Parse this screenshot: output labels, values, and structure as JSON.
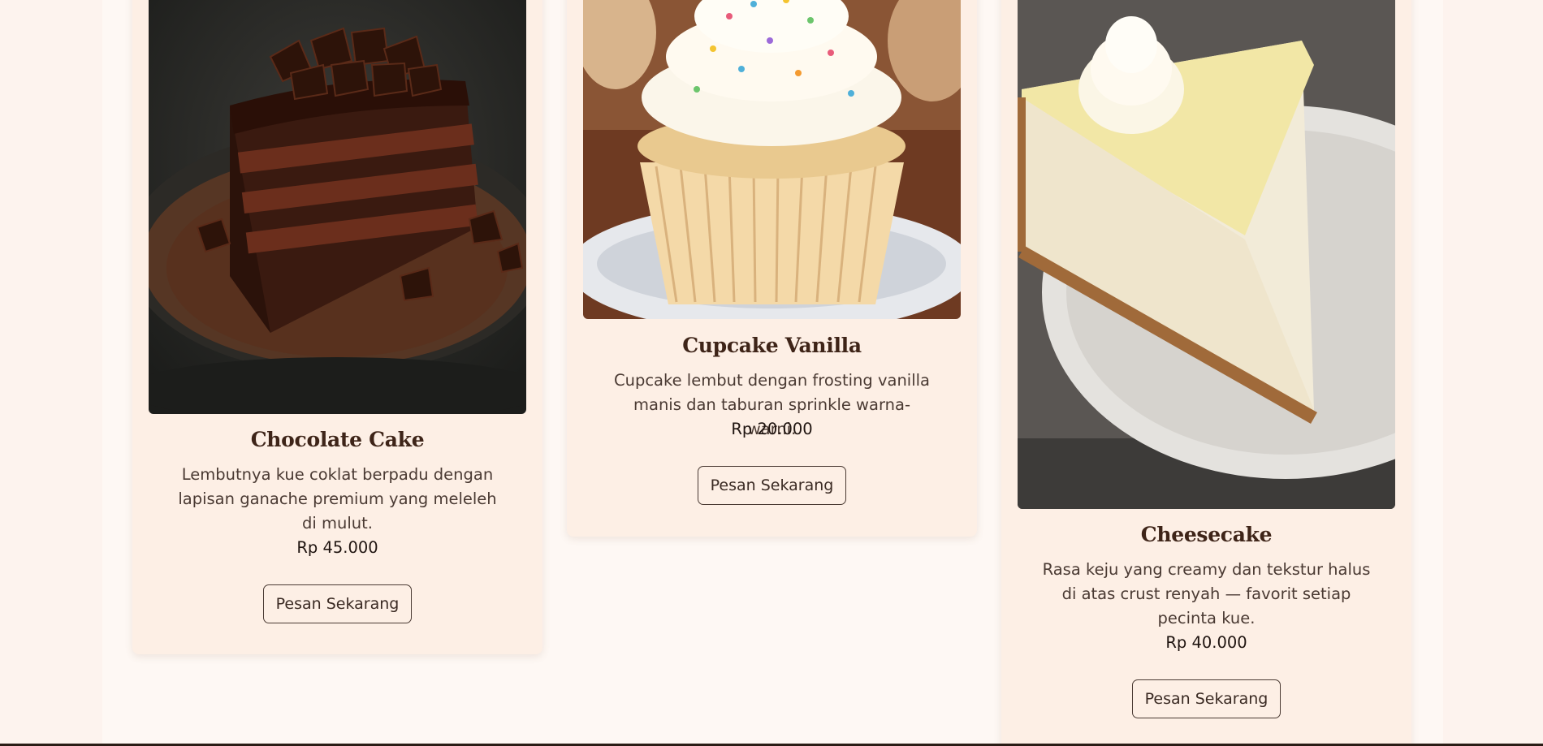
{
  "products": [
    {
      "name": "Chocolate Cake",
      "description": "Lembutnya kue coklat berpadu dengan lapisan ganache premium yang meleleh di mulut.",
      "price": "Rp 45.000",
      "button_label": "Pesan Sekarang",
      "image_icon": "chocolate-cake-image"
    },
    {
      "name": "Cupcake Vanilla",
      "description": "Cupcake lembut dengan frosting vanilla manis dan taburan sprinkle warna-warni.",
      "price": "Rp 20.000",
      "button_label": "Pesan Sekarang",
      "image_icon": "cupcake-image"
    },
    {
      "name": "Cheesecake",
      "description": "Rasa keju yang creamy dan tekstur halus di atas crust renyah — favorit setiap pecinta kue.",
      "price": "Rp 40.000",
      "button_label": "Pesan Sekarang",
      "image_icon": "cheesecake-image"
    }
  ],
  "colors": {
    "page_bg": "#fdf3ee",
    "panel_bg": "#fef8f4",
    "card_bg": "#fdefe5",
    "title": "#3e2418",
    "text": "#4a3a33"
  }
}
